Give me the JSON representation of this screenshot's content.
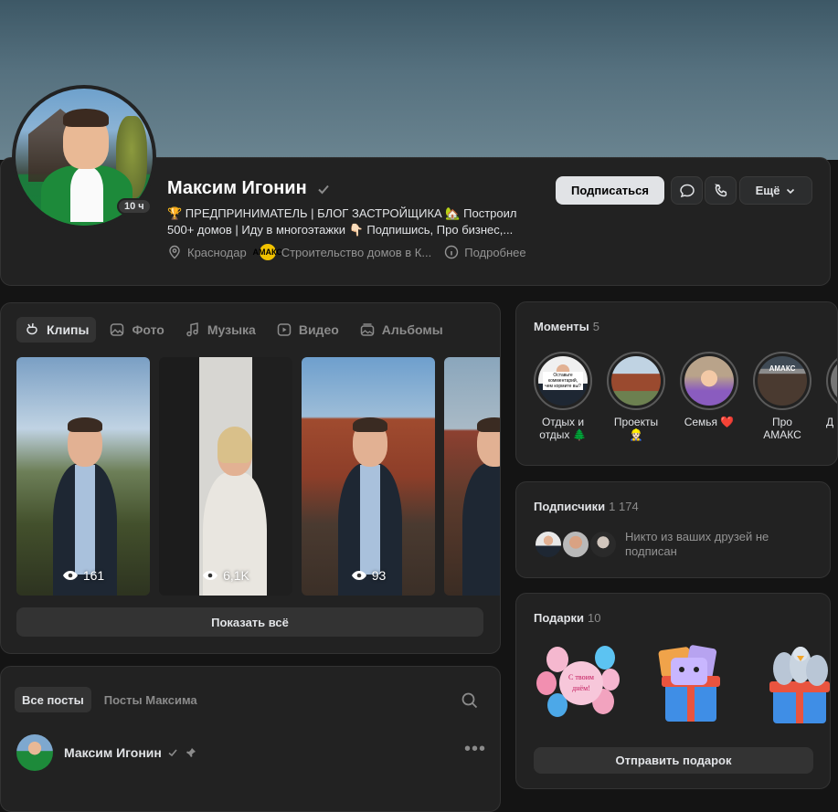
{
  "profile": {
    "name": "Максим Игонин",
    "story_age": "10 ч",
    "bio": "🏆 ПРЕДПРИНИМАТЕЛЬ | БЛОГ ЗАСТРОЙЩИКА 🏡 Построил 500+ домов | Иду в многоэтажки 👇🏻 Подпишись, Про бизнес,...",
    "city": "Краснодар",
    "company_badge": "АМАКС",
    "company": "Строительство домов в К...",
    "details_link": "Подробнее",
    "subscribe_label": "Подписаться",
    "more_label": "Ещё"
  },
  "media": {
    "tabs": [
      {
        "label": "Клипы",
        "icon": "clips-icon"
      },
      {
        "label": "Фото",
        "icon": "photo-icon"
      },
      {
        "label": "Музыка",
        "icon": "music-icon"
      },
      {
        "label": "Видео",
        "icon": "video-icon"
      },
      {
        "label": "Альбомы",
        "icon": "albums-icon"
      }
    ],
    "clips": [
      {
        "views": "161"
      },
      {
        "views": "6,1K"
      },
      {
        "views": "93"
      },
      {
        "views": ""
      }
    ],
    "show_all_label": "Показать всё"
  },
  "posts": {
    "tabs": [
      "Все посты",
      "Посты Максима"
    ],
    "author": "Максим Игонин"
  },
  "moments": {
    "title": "Моменты",
    "count": "5",
    "items": [
      {
        "label": "Отдых и отдых 🌲"
      },
      {
        "label": "Проекты 👷🏻"
      },
      {
        "label": "Семья ❤️"
      },
      {
        "label": "Про АМАКС"
      },
      {
        "label": "Д"
      }
    ],
    "m1_text": "Оставьте комментарий, чем кормите вы?",
    "m4_text": "АМАКС"
  },
  "subscribers": {
    "title": "Подписчики",
    "count": "1 174",
    "note": "Никто из ваших друзей не подписан"
  },
  "gifts": {
    "title": "Подарки",
    "count": "10",
    "balloon_text": "С твоим днём!",
    "send_label": "Отправить подарок"
  },
  "colors": {
    "background": "#141414",
    "panel": "#222222",
    "accent_button": "#e1e3e6",
    "badge_yellow": "#f2c200"
  }
}
